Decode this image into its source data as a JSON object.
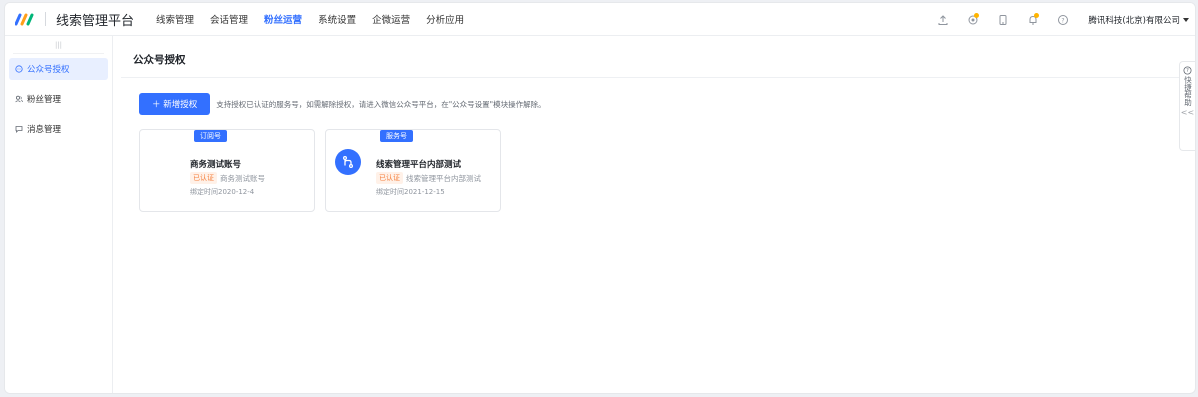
{
  "header": {
    "app_title": "线索管理平台",
    "nav": [
      "线索管理",
      "会话管理",
      "粉丝运营",
      "系统设置",
      "企微运营",
      "分析应用"
    ],
    "active_nav_index": 2,
    "tools": [
      "upload-icon",
      "badge-icon",
      "tablet-icon",
      "bell-icon",
      "help-icon"
    ],
    "company": "腾讯科技(北京)有限公司"
  },
  "sidebar": {
    "collapse_label": "|||",
    "items": [
      {
        "label": "公众号授权",
        "icon": "chat-bubble-icon",
        "active": true
      },
      {
        "label": "粉丝管理",
        "icon": "users-icon",
        "active": false
      },
      {
        "label": "消息管理",
        "icon": "message-icon",
        "active": false
      }
    ]
  },
  "main": {
    "page_title": "公众号授权",
    "new_auth_button": "＋ 新增授权",
    "hint": "支持授权已认证的服务号，如需解除授权，请进入微信公众号平台，在\"公众号设置\"模块操作解除。",
    "cards": [
      {
        "tag": "订阅号",
        "name": "商务测试账号",
        "verified": "已认证",
        "verify_name": "商务测试账号",
        "date": "绑定时间2020-12-4",
        "has_avatar": false
      },
      {
        "tag": "服务号",
        "name": "线索管理平台内部测试",
        "verified": "已认证",
        "verify_name": "线索管理平台内部测试",
        "date": "绑定时间2021-12-15",
        "has_avatar": true
      }
    ]
  },
  "help": {
    "label": "快捷帮助",
    "collapse": "<<"
  },
  "colors": {
    "primary": "#3370ff",
    "verified_text": "#f5803e",
    "active_bg": "#e8efff"
  }
}
